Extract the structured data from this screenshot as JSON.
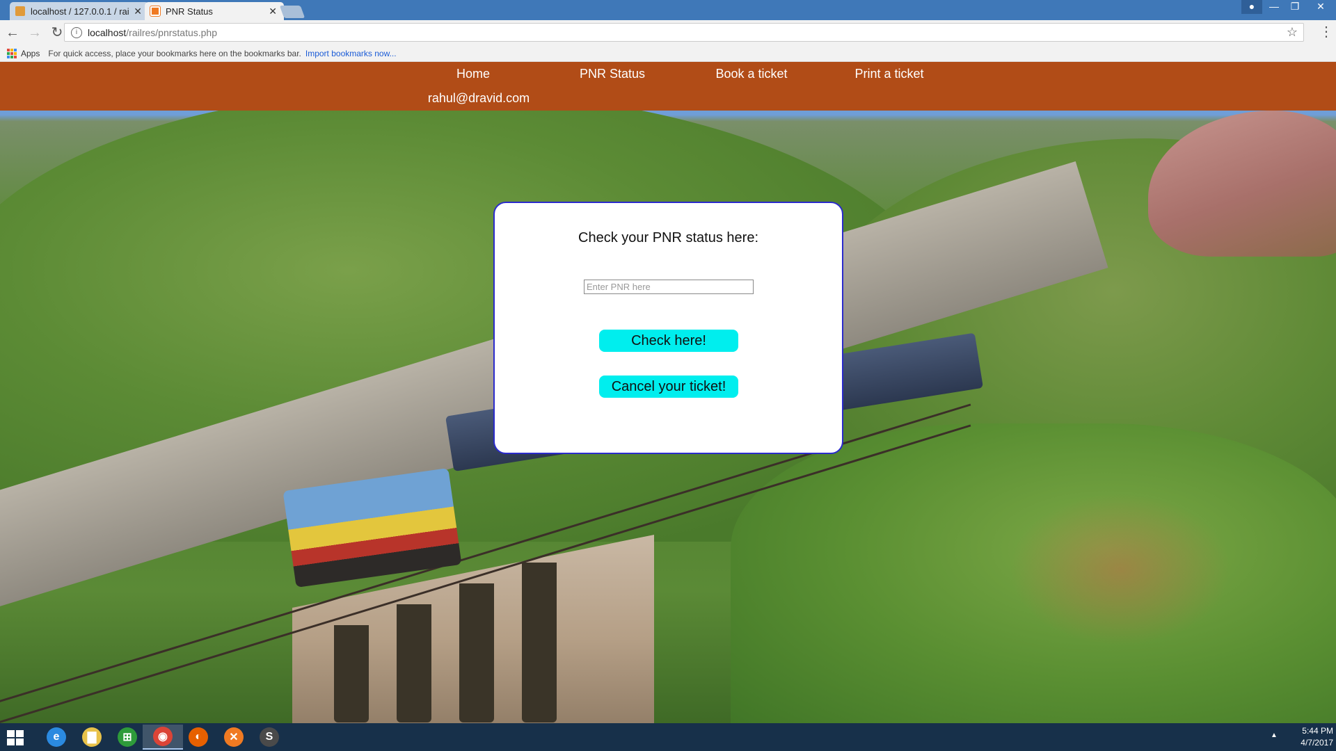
{
  "browser": {
    "tabs": [
      {
        "title": "localhost / 127.0.0.1 / rai",
        "active": false
      },
      {
        "title": "PNR Status",
        "active": true
      }
    ],
    "url_host": "localhost",
    "url_path": "/railres/pnrstatus.php",
    "bookmarks": {
      "apps_label": "Apps",
      "hint": "For quick access, place your bookmarks here on the bookmarks bar.",
      "import_link": "Import bookmarks now..."
    },
    "icons": {
      "back": "←",
      "forward": "→",
      "reload": "↻",
      "info": "i",
      "star": "☆",
      "menu": "⋮",
      "close_tab": "✕",
      "minimize": "—",
      "maximize": "❐",
      "close_window": "✕"
    }
  },
  "nav": {
    "home": "Home",
    "pnr_status": "PNR Status",
    "book": "Book a ticket",
    "print": "Print a ticket",
    "user": "rahul@dravid.com"
  },
  "card": {
    "title": "Check your PNR status here:",
    "input_placeholder": "Enter PNR here",
    "input_value": "",
    "check_button": "Check here!",
    "cancel_button": "Cancel your ticket!"
  },
  "taskbar": {
    "time": "5:44 PM",
    "date": "4/7/2017",
    "apps": [
      {
        "name": "internet-explorer",
        "glyph": "e",
        "color": "#2b8ae0"
      },
      {
        "name": "file-explorer",
        "glyph": "▇",
        "color": "#e8c24a"
      },
      {
        "name": "store",
        "glyph": "⊞",
        "color": "#2e9b3a"
      },
      {
        "name": "chrome",
        "glyph": "◉",
        "color": "#db4437"
      },
      {
        "name": "firefox",
        "glyph": "◐",
        "color": "#e66000"
      },
      {
        "name": "xampp",
        "glyph": "✕",
        "color": "#f07a22"
      },
      {
        "name": "sublime-text",
        "glyph": "S",
        "color": "#4a4a4a"
      }
    ]
  },
  "colors": {
    "nav_bg": "#b14c17",
    "button_bg": "#00eeee",
    "card_border": "#2b2bcc",
    "tabstrip": "#3f78b8"
  }
}
